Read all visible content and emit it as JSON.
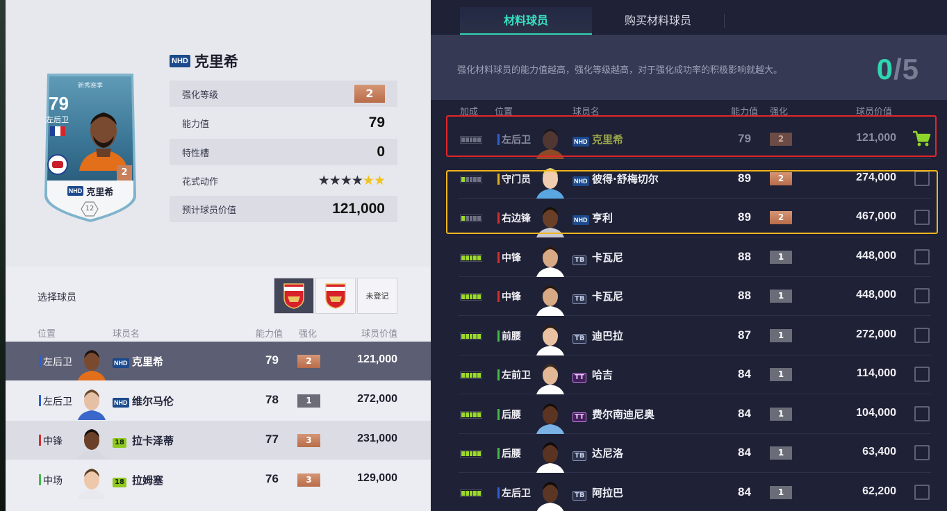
{
  "colors": {
    "accent": "#31d4b4",
    "bronze": "#c8805b",
    "pos_defender": "#2f5fd0",
    "pos_forward": "#d03030",
    "pos_midfield": "#45b84a",
    "pos_keeper": "#e3b21a",
    "highlight_red": "#e3262b",
    "highlight_yellow": "#f2b61d"
  },
  "card": {
    "season": "新秀赛季",
    "ovr": "79",
    "position": "左后卫",
    "upgrade": "2",
    "tag": "NHD",
    "name": "克里希",
    "level": "12"
  },
  "detail": {
    "tag": "NHD",
    "name": "克里希",
    "stats": [
      {
        "label": "强化等级",
        "value": "2"
      },
      {
        "label": "能力值",
        "value": "79"
      },
      {
        "label": "特性槽",
        "value": "0"
      },
      {
        "label": "花式动作",
        "value": "",
        "stars_filled": 4,
        "stars_total": 6
      },
      {
        "label": "预计球员价值",
        "value": "121,000"
      }
    ]
  },
  "selection": {
    "title": "选择球员",
    "filters": [
      "arsenal-crest",
      "arsenal-crest",
      "未登记"
    ],
    "headers": {
      "position": "位置",
      "name": "球员名",
      "ovr": "能力值",
      "upgrade": "强化",
      "price": "球员价值"
    },
    "rows": [
      {
        "position": "左后卫",
        "pos_color": "#2f5fd0",
        "tag": "NHD",
        "name": "克里希",
        "ovr": "79",
        "upgrade": "2",
        "upg_style": "bronze",
        "price": "121,000"
      },
      {
        "position": "左后卫",
        "pos_color": "#2f5fd0",
        "tag": "NHD",
        "name": "维尔马伦",
        "ovr": "78",
        "upgrade": "1",
        "upg_style": "gray",
        "price": "272,000"
      },
      {
        "position": "中锋",
        "pos_color": "#d03030",
        "tag": "18",
        "name": "拉卡泽蒂",
        "ovr": "77",
        "upgrade": "3",
        "upg_style": "bronze",
        "price": "231,000"
      },
      {
        "position": "中场",
        "pos_color": "#45b84a",
        "tag": "18",
        "name": "拉姆塞",
        "ovr": "76",
        "upgrade": "3",
        "upg_style": "bronze",
        "price": "129,000"
      }
    ]
  },
  "right": {
    "tabs": [
      "材料球员",
      "购买材料球员"
    ],
    "info": "强化材料球员的能力值越高，强化等级越高，对于强化成功率的积极影响就越大。",
    "counter_current": "0",
    "counter_total": "/5",
    "headers": {
      "boost": "加成",
      "position": "位置",
      "name": "球员名",
      "ovr": "能力值",
      "upgrade": "强化",
      "price": "球员价值"
    },
    "rows": [
      {
        "boost": 0,
        "position": "左后卫",
        "pos_color": "#2f5fd0",
        "tag": "NHD",
        "name": "克里希",
        "ovr": "79",
        "upgrade": "2",
        "upg_style": "dim",
        "price": "121,000",
        "action": "cart",
        "dim": true
      },
      {
        "boost": 1,
        "position": "守门员",
        "pos_color": "#e3b21a",
        "tag": "NHD",
        "name": "彼得·舒梅切尔",
        "ovr": "89",
        "upgrade": "2",
        "upg_style": "bronze",
        "price": "274,000",
        "action": "checkbox"
      },
      {
        "boost": 1,
        "position": "右边锋",
        "pos_color": "#d03030",
        "tag": "NHD",
        "name": "亨利",
        "ovr": "89",
        "upgrade": "2",
        "upg_style": "bronze",
        "price": "467,000",
        "action": "checkbox"
      },
      {
        "boost": 5,
        "position": "中锋",
        "pos_color": "#d03030",
        "tag": "TB",
        "name": "卡瓦尼",
        "ovr": "88",
        "upgrade": "1",
        "upg_style": "gray",
        "price": "448,000",
        "action": "checkbox"
      },
      {
        "boost": 5,
        "position": "中锋",
        "pos_color": "#d03030",
        "tag": "TB",
        "name": "卡瓦尼",
        "ovr": "88",
        "upgrade": "1",
        "upg_style": "gray",
        "price": "448,000",
        "action": "checkbox"
      },
      {
        "boost": 5,
        "position": "前腰",
        "pos_color": "#45b84a",
        "tag": "TB",
        "name": "迪巴拉",
        "ovr": "87",
        "upgrade": "1",
        "upg_style": "gray",
        "price": "272,000",
        "action": "checkbox"
      },
      {
        "boost": 5,
        "position": "左前卫",
        "pos_color": "#45b84a",
        "tag": "TT",
        "name": "哈吉",
        "ovr": "84",
        "upgrade": "1",
        "upg_style": "gray",
        "price": "114,000",
        "action": "checkbox"
      },
      {
        "boost": 5,
        "position": "后腰",
        "pos_color": "#45b84a",
        "tag": "TT",
        "name": "费尔南迪尼奥",
        "ovr": "84",
        "upgrade": "1",
        "upg_style": "gray",
        "price": "104,000",
        "action": "checkbox"
      },
      {
        "boost": 5,
        "position": "后腰",
        "pos_color": "#45b84a",
        "tag": "TB",
        "name": "达尼洛",
        "ovr": "84",
        "upgrade": "1",
        "upg_style": "gray",
        "price": "63,400",
        "action": "checkbox"
      },
      {
        "boost": 5,
        "position": "左后卫",
        "pos_color": "#2f5fd0",
        "tag": "TB",
        "name": "阿拉巴",
        "ovr": "84",
        "upgrade": "1",
        "upg_style": "gray",
        "price": "62,200",
        "action": "checkbox"
      }
    ]
  }
}
